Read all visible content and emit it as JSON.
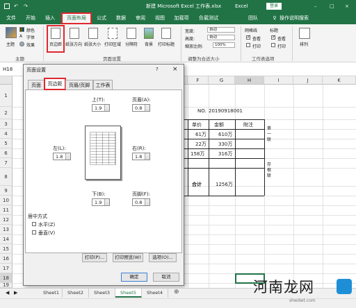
{
  "title_bar": {
    "file_title": "新建 Microsoft Excel 工作表.xlsx",
    "app": "Excel",
    "login_button": "登录"
  },
  "ribbon_tabs": [
    "文件",
    "开始",
    "插入",
    "页面布局",
    "公式",
    "数据",
    "审阅",
    "视图",
    "加载项",
    "负载测试",
    "团队"
  ],
  "active_ribbon_tab": "页面布局",
  "tell_me": "操作说明搜索",
  "ribbon": {
    "theme_group": {
      "theme": "主题",
      "colors": "颜色",
      "fonts": "字体",
      "effects": "效果",
      "group_label": "主题"
    },
    "page_setup_group": {
      "margins": "页边距",
      "orientation": "纸张方向",
      "size": "纸张大小",
      "print_area": "打印区域",
      "breaks": "分隔符",
      "background": "背景",
      "print_titles": "打印标题",
      "group_label": "页面设置"
    },
    "scale_group": {
      "width_label": "宽度:",
      "width_value": "自动",
      "height_label": "高度:",
      "height_value": "自动",
      "scale_label": "缩放比例:",
      "scale_value": "100%",
      "group_label": "调整为合适大小"
    },
    "sheet_options_group": {
      "gridlines": "网格线",
      "headings": "标题",
      "view": "查看",
      "print": "打印",
      "group_label": "工作表选项"
    },
    "arrange_group": {
      "arrange": "排列"
    }
  },
  "name_box": "H18",
  "columns": [
    "E",
    "F",
    "G",
    "H",
    "I",
    "J",
    "K"
  ],
  "rows": [
    "1",
    "2",
    "3",
    "4",
    "5",
    "6",
    "7",
    "8",
    "9",
    "10",
    "11",
    "12",
    "13",
    "14",
    "15",
    "16",
    "17",
    "18",
    "19",
    "20"
  ],
  "sheet_cells": {
    "no_label": "NO.",
    "no_value": "20190918001",
    "hdr_price": "单价",
    "hdr_amount": "金额",
    "hdr_note": "附注",
    "r3_price": "61万",
    "r3_amount": "610万",
    "r4_price": "22万",
    "r4_amount": "330万",
    "r5_price": "158万",
    "r5_amount": "316万",
    "total_label": "合计",
    "total_value": "1256万",
    "side_1": "第一联",
    "side_2": "存根联"
  },
  "dialog": {
    "title": "页面设置",
    "help": "?",
    "close": "×",
    "tabs": [
      "页面",
      "页边距",
      "页眉/页脚",
      "工作表"
    ],
    "active_tab": "页边距",
    "top_label": "上(T):",
    "top_value": "1.9",
    "header_label": "页眉(A):",
    "header_value": "0.8",
    "left_label": "左(L):",
    "left_value": "1.8",
    "right_label": "右(R):",
    "right_value": "1.8",
    "bottom_label": "下(B):",
    "bottom_value": "1.9",
    "footer_label": "页脚(F):",
    "footer_value": "0.8",
    "center_label": "居中方式",
    "horizontal": "水平(Z)",
    "vertical": "垂直(V)",
    "print_btn": "打印(P)...",
    "preview_btn": "打印预览(W)",
    "options_btn": "选项(O)...",
    "ok_btn": "确定",
    "cancel_btn": "取消"
  },
  "sheet_tabs": [
    "Sheet1",
    "Sheet2",
    "Sheet3",
    "Sheet5",
    "Sheet4"
  ],
  "active_sheet": "Sheet5",
  "watermark": {
    "text": "河南龙网",
    "url": "shwdwt.com"
  },
  "colors": {
    "excel_green": "#217346",
    "highlight_red": "#e0282e"
  }
}
